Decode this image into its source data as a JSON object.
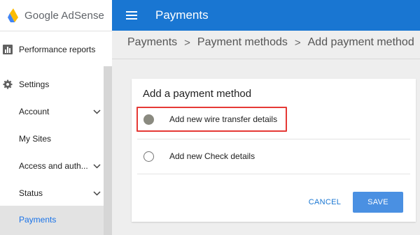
{
  "app": {
    "logo_text": "Google AdSense"
  },
  "header": {
    "title": "Payments"
  },
  "sidebar": {
    "items": [
      {
        "label": "Performance reports"
      },
      {
        "label": "Settings"
      }
    ],
    "subitems": [
      {
        "label": "Account"
      },
      {
        "label": "My Sites"
      },
      {
        "label": "Access and auth..."
      },
      {
        "label": "Status"
      },
      {
        "label": "Payments"
      }
    ]
  },
  "breadcrumb": [
    "Payments",
    "Payment methods",
    "Add payment method"
  ],
  "card": {
    "title": "Add a payment method",
    "options": [
      {
        "label": "Add new wire transfer details",
        "selected": true
      },
      {
        "label": "Add new Check details",
        "selected": false
      }
    ],
    "cancel_label": "CANCEL",
    "save_label": "SAVE"
  },
  "colors": {
    "topbar": "#1976d2",
    "accent": "#1a73e8",
    "save_button": "#4a90e2",
    "highlight": "#e53935"
  }
}
